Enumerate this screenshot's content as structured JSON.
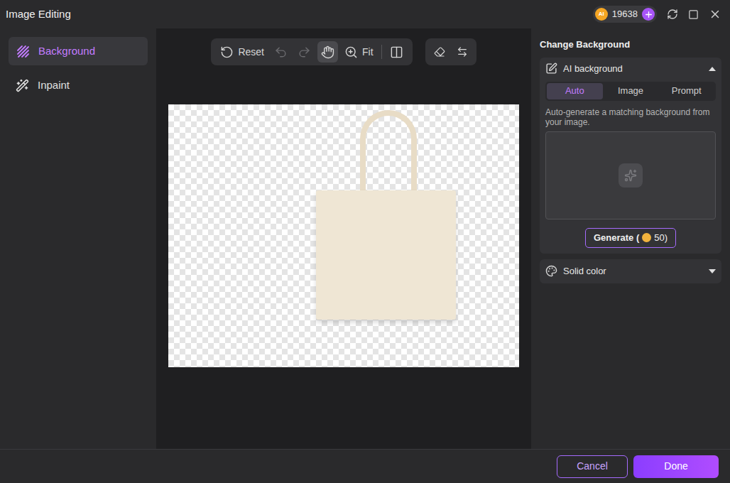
{
  "window": {
    "title": "Image Editing"
  },
  "credits": {
    "badge": "AI",
    "count": "19638"
  },
  "sidebar": {
    "items": [
      {
        "label": "Background",
        "selected": true
      },
      {
        "label": "Inpaint",
        "selected": false
      }
    ]
  },
  "toolbar": {
    "items": [
      {
        "kind": "reset",
        "label": "Reset",
        "disabled": false,
        "selected": false
      },
      {
        "kind": "undo",
        "label": "",
        "disabled": true,
        "selected": false
      },
      {
        "kind": "redo",
        "label": "",
        "disabled": true,
        "selected": false
      },
      {
        "kind": "hand",
        "label": "",
        "disabled": false,
        "selected": true
      },
      {
        "kind": "zoom",
        "label": "Fit",
        "disabled": false,
        "selected": false
      },
      {
        "kind": "compare",
        "label": "",
        "disabled": false,
        "selected": false
      }
    ],
    "extra": [
      {
        "kind": "erase",
        "disabled": false
      },
      {
        "kind": "swap",
        "disabled": false
      }
    ]
  },
  "panel": {
    "title": "Change Background",
    "ai_background": {
      "label": "AI background",
      "expanded": true,
      "tabs": [
        {
          "label": "Auto",
          "selected": true
        },
        {
          "label": "Image",
          "selected": false
        },
        {
          "label": "Prompt",
          "selected": false
        }
      ],
      "description": "Auto-generate a matching background from your image.",
      "generate": {
        "label": "Generate (",
        "cost": "50)"
      }
    },
    "solid_color": {
      "label": "Solid color",
      "expanded": false
    }
  },
  "buttons": [
    {
      "label": "Cancel",
      "kind": "secondary"
    },
    {
      "label": "Done",
      "kind": "primary"
    }
  ]
}
